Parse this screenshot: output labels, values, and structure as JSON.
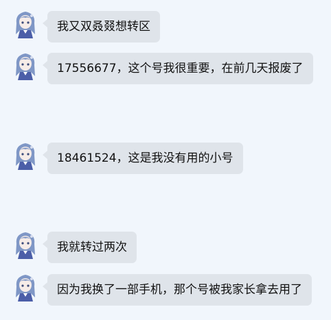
{
  "messages": [
    {
      "text": "我又双叒叕想转区"
    },
    {
      "text": "17556677，这个号我很重要，在前几天报废了"
    },
    {
      "text": "18461524，这是我没有用的小号"
    },
    {
      "text": "我就转过两次"
    },
    {
      "text": "因为我换了一部手机，那个号被我家长拿去用了"
    }
  ],
  "colors": {
    "background": "#f1f6fc",
    "bubble": "#dfe4ea",
    "avatar_hair": "#7f97c6",
    "avatar_dress": "#4b5ea8"
  },
  "icons": {
    "avatar": "anime-girl-avatar-icon"
  }
}
